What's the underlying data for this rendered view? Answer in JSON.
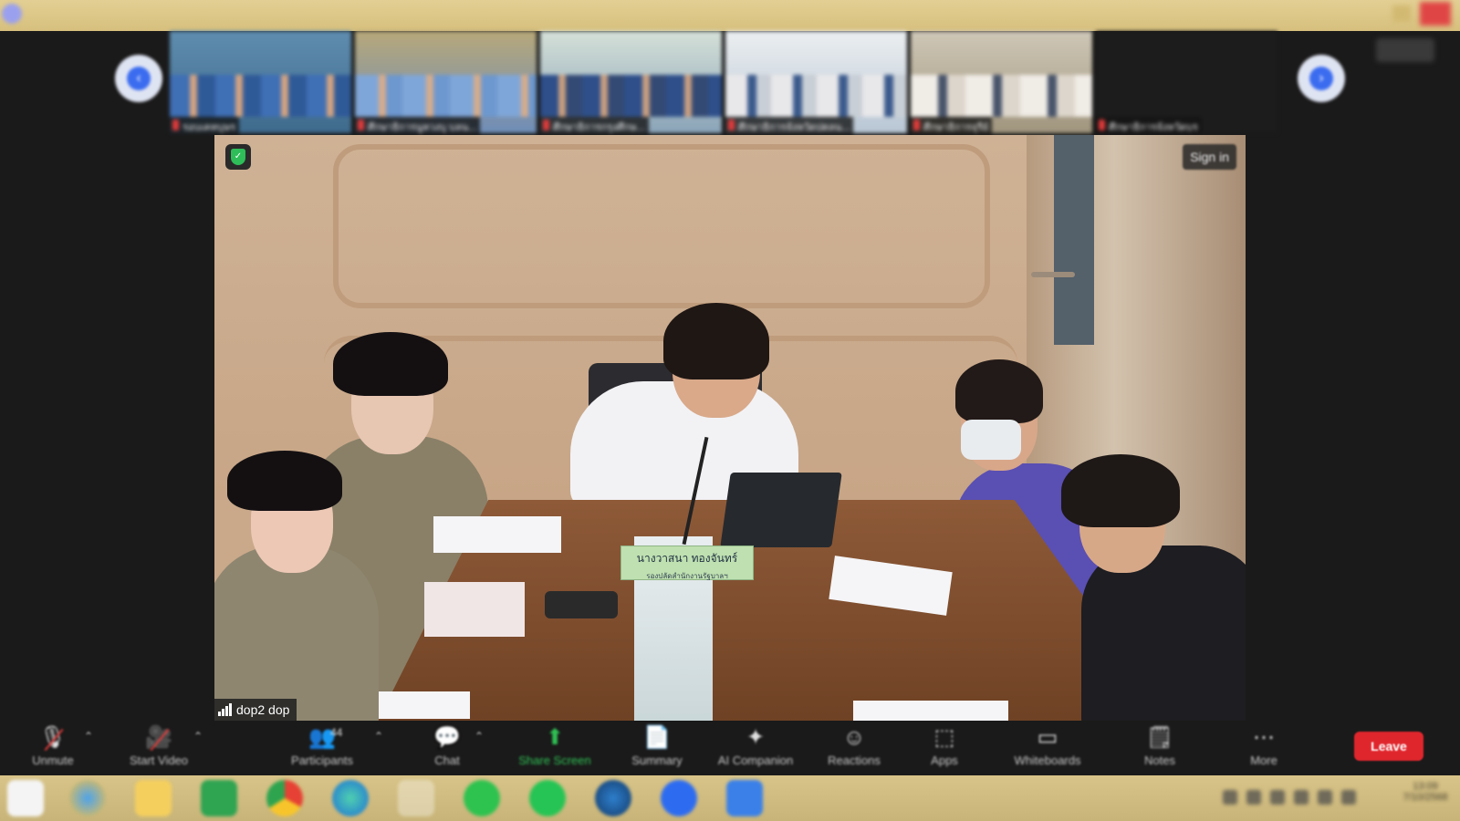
{
  "window": {
    "title": ""
  },
  "thumbnails": [
    {
      "name": "รอบเคหบุษร"
    },
    {
      "name": "ศึกษาธิการนูหวงบุ บลน..."
    },
    {
      "name": "ศึกษาธิการกรุงศึกษ..."
    },
    {
      "name": "ศึกษาธิการจังหวัดปตลน..."
    },
    {
      "name": "ศึกษาธิการจุรีย์"
    },
    {
      "name": "ศึกษาธิการจังหวัดบร"
    }
  ],
  "main_video": {
    "sign_in_label": "Sign in",
    "speaker_name": "dop2 dop",
    "nameplate": {
      "name": "นางวาสนา ทองจันทร์",
      "role": "รองปลัดสำนักงานรัฐบาลฯ"
    }
  },
  "toolbar": {
    "unmute": "Unmute",
    "start_video": "Start Video",
    "participants": "Participants",
    "participants_count": "44",
    "chat": "Chat",
    "share_screen": "Share Screen",
    "summary": "Summary",
    "ai_companion": "AI Companion",
    "reactions": "Reactions",
    "apps": "Apps",
    "whiteboards": "Whiteboards",
    "notes": "Notes",
    "more": "More",
    "leave": "Leave"
  },
  "taskbar": {
    "clock_time": "13:09",
    "clock_date": "7/10/2568"
  },
  "colors": {
    "leave_red": "#e0262d",
    "share_green": "#2fbf53",
    "toolbar_bg": "#1a1a1a"
  }
}
